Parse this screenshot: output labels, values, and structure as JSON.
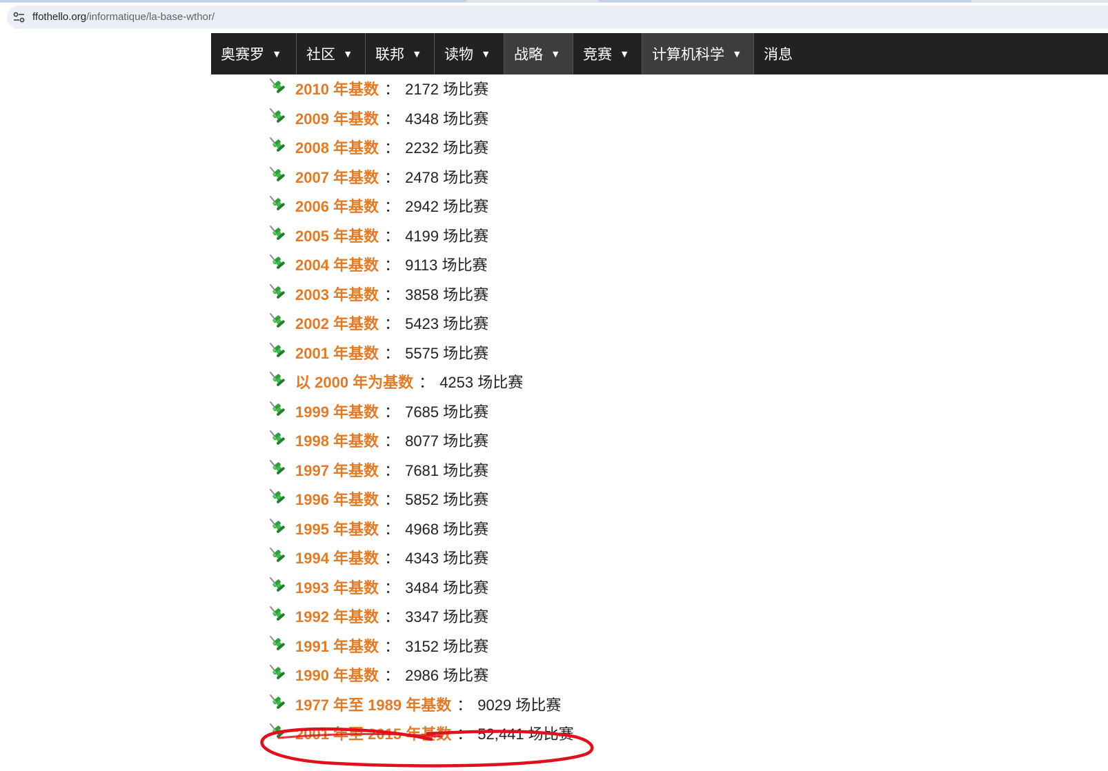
{
  "browser": {
    "url_host": "ffothello.org",
    "url_path": "/informatique/la-base-wthor/",
    "site_info_icon": "tune-icon"
  },
  "nav": {
    "items": [
      {
        "label": "奥赛罗",
        "has_dropdown": true,
        "active": false
      },
      {
        "label": "社区",
        "has_dropdown": true,
        "active": false
      },
      {
        "label": "联邦",
        "has_dropdown": true,
        "active": false
      },
      {
        "label": "读物",
        "has_dropdown": true,
        "active": false
      },
      {
        "label": "战略",
        "has_dropdown": true,
        "active": true
      },
      {
        "label": "竞赛",
        "has_dropdown": true,
        "active": false
      },
      {
        "label": "计算机科学",
        "has_dropdown": true,
        "active": true
      },
      {
        "label": "消息",
        "has_dropdown": false,
        "active": false
      }
    ],
    "dropdown_arrow": "▼"
  },
  "list": {
    "separator": "：",
    "bullet_icon": "green-pushpin-icon",
    "entries": [
      {
        "link": "2010 年基数",
        "count": "2172 场比赛"
      },
      {
        "link": "2009 年基数",
        "count": "4348 场比赛"
      },
      {
        "link": "2008 年基数",
        "count": "2232 场比赛"
      },
      {
        "link": "2007 年基数",
        "count": "2478 场比赛"
      },
      {
        "link": "2006 年基数",
        "count": "2942 场比赛"
      },
      {
        "link": "2005 年基数",
        "count": "4199 场比赛"
      },
      {
        "link": "2004 年基数",
        "count": "9113 场比赛"
      },
      {
        "link": "2003 年基数",
        "count": "3858 场比赛"
      },
      {
        "link": "2002 年基数",
        "count": "5423 场比赛"
      },
      {
        "link": "2001 年基数",
        "count": "5575 场比赛"
      },
      {
        "link": "以 2000 年为基数",
        "count": "4253 场比赛"
      },
      {
        "link": "1999 年基数",
        "count": "7685 场比赛"
      },
      {
        "link": "1998 年基数",
        "count": "8077 场比赛"
      },
      {
        "link": "1997 年基数",
        "count": "7681 场比赛"
      },
      {
        "link": "1996 年基数",
        "count": "5852 场比赛"
      },
      {
        "link": "1995 年基数",
        "count": "4968 场比赛"
      },
      {
        "link": "1994 年基数",
        "count": "4343 场比赛"
      },
      {
        "link": "1993 年基数",
        "count": "3484 场比赛"
      },
      {
        "link": "1992 年基数",
        "count": "3347 场比赛"
      },
      {
        "link": "1991 年基数",
        "count": "3152 场比赛"
      },
      {
        "link": "1990 年基数",
        "count": "2986 场比赛"
      },
      {
        "link": "1977 年至 1989 年基数",
        "count": "9029 场比赛"
      },
      {
        "link": "2001 年至 2015 年基数",
        "count": "52,441 场比赛"
      }
    ]
  },
  "colors": {
    "link": "#e07b28",
    "nav_bg": "#222222",
    "nav_active_bg": "#3d3d3d",
    "annotation": "#e0101e"
  },
  "annotation": {
    "type": "hand-drawn-ellipse",
    "target": "2001 年至 2015 年基数"
  }
}
